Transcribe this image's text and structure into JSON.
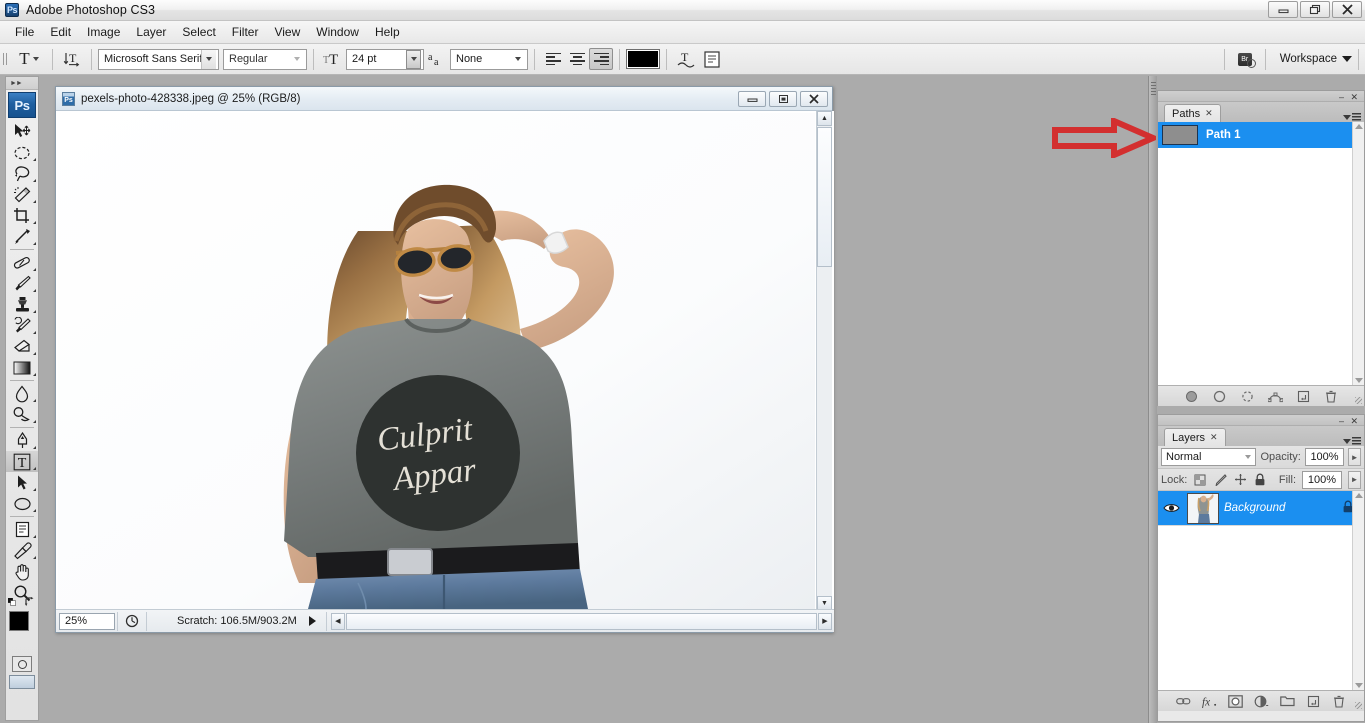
{
  "app": {
    "title": "Adobe Photoshop CS3",
    "logo_text": "Ps",
    "window_buttons": [
      {
        "name": "minimize",
        "glyph": "–"
      },
      {
        "name": "restore",
        "glyph": "❐"
      },
      {
        "name": "close",
        "glyph": "✕"
      }
    ]
  },
  "menubar": {
    "items": [
      "File",
      "Edit",
      "Image",
      "Layer",
      "Select",
      "Filter",
      "View",
      "Window",
      "Help"
    ]
  },
  "options_bar": {
    "tool_icon": "type-tool-icon",
    "tool_preset_label": "T",
    "orientation_icon": "text-orientation-icon",
    "font_family": "Microsoft Sans Serif",
    "font_style": "Regular",
    "font_size": "24 pt",
    "anti_alias_icon": "anti-alias-icon",
    "anti_alias": "None",
    "align": [
      "align-left",
      "align-center",
      "align-right"
    ],
    "align_active": "align-right",
    "text_color": "#000000",
    "warp_icon": "warp-text-icon",
    "palette_icon": "character-paragraph-panel-icon",
    "bridge_label": "Br",
    "workspace_label": "Workspace"
  },
  "toolbox": {
    "logo": "Ps",
    "tools": [
      {
        "name": "move-tool",
        "selected": false,
        "has_submenu": false
      },
      {
        "name": "marquee-tool",
        "selected": false,
        "has_submenu": true
      },
      {
        "name": "lasso-tool",
        "selected": false,
        "has_submenu": true
      },
      {
        "name": "magic-wand-tool",
        "selected": false,
        "has_submenu": true
      },
      {
        "name": "crop-tool",
        "selected": false,
        "has_submenu": true
      },
      {
        "name": "slice-tool",
        "selected": false,
        "has_submenu": true
      },
      {
        "name": "healing-brush-tool",
        "selected": false,
        "has_submenu": true
      },
      {
        "name": "brush-tool",
        "selected": false,
        "has_submenu": true
      },
      {
        "name": "clone-stamp-tool",
        "selected": false,
        "has_submenu": true
      },
      {
        "name": "history-brush-tool",
        "selected": false,
        "has_submenu": true
      },
      {
        "name": "eraser-tool",
        "selected": false,
        "has_submenu": true
      },
      {
        "name": "gradient-tool",
        "selected": false,
        "has_submenu": true
      },
      {
        "name": "blur-tool",
        "selected": false,
        "has_submenu": true
      },
      {
        "name": "dodge-tool",
        "selected": false,
        "has_submenu": true
      },
      {
        "name": "pen-tool",
        "selected": false,
        "has_submenu": true
      },
      {
        "name": "type-tool",
        "selected": true,
        "has_submenu": true
      },
      {
        "name": "path-selection-tool",
        "selected": false,
        "has_submenu": true
      },
      {
        "name": "shape-tool",
        "selected": false,
        "has_submenu": true
      },
      {
        "name": "notes-tool",
        "selected": false,
        "has_submenu": true
      },
      {
        "name": "eyedropper-tool",
        "selected": false,
        "has_submenu": true
      },
      {
        "name": "hand-tool",
        "selected": false,
        "has_submenu": false
      },
      {
        "name": "zoom-tool",
        "selected": false,
        "has_submenu": false
      }
    ],
    "foreground_color": "#000000",
    "background_color": "#3fd36a",
    "quick_mask_icon": "quick-mask-icon",
    "screen_mode_icon": "screen-mode-icon"
  },
  "document": {
    "title": "pexels-photo-428338.jpeg @ 25% (RGB/8)",
    "window_buttons": [
      {
        "name": "minimize",
        "glyph": "–"
      },
      {
        "name": "maximize",
        "glyph": "□"
      },
      {
        "name": "close",
        "glyph": "✕"
      }
    ],
    "zoom_level": "25%",
    "status_text": "Scratch: 106.5M/903.2M",
    "image_alt": "Blonde woman in sunglasses wearing grey Culprit Apparel t-shirt and blue jeans on white background",
    "shirt_text_line1": "Culprit",
    "shirt_text_line2": "Appar"
  },
  "paths_panel": {
    "tab_label": "Paths",
    "close_glyph": "✕",
    "items": [
      {
        "name": "Path 1",
        "selected": true
      }
    ],
    "footer_icons": [
      "fill-path-icon",
      "stroke-path-icon",
      "load-path-as-selection-icon",
      "make-work-path-icon",
      "new-path-icon",
      "delete-path-icon"
    ]
  },
  "layers_panel": {
    "tab_label": "Layers",
    "close_glyph": "✕",
    "blend_mode": "Normal",
    "opacity_label": "Opacity:",
    "opacity_value": "100%",
    "lock_label": "Lock:",
    "lock_icons": [
      "lock-transparent-pixels-icon",
      "lock-image-pixels-icon",
      "lock-position-icon",
      "lock-all-icon"
    ],
    "fill_label": "Fill:",
    "fill_value": "100%",
    "layers": [
      {
        "name": "Background",
        "visible": true,
        "locked": true,
        "selected": true
      }
    ],
    "footer_icons": [
      "link-layers-icon",
      "layer-style-fx-icon",
      "add-layer-mask-icon",
      "new-adjustment-layer-icon",
      "new-group-icon",
      "new-layer-icon",
      "delete-layer-icon"
    ]
  },
  "annotation": {
    "arrow": {
      "name": "red-pointer-arrow",
      "color": "#d32f2f",
      "points_to": "Path 1"
    }
  },
  "colors": {
    "workspace_bg": "#ababab",
    "selection_blue": "#1b8ff0",
    "panel_bg": "#e9e9e9",
    "annotation_red": "#d32f2f"
  }
}
